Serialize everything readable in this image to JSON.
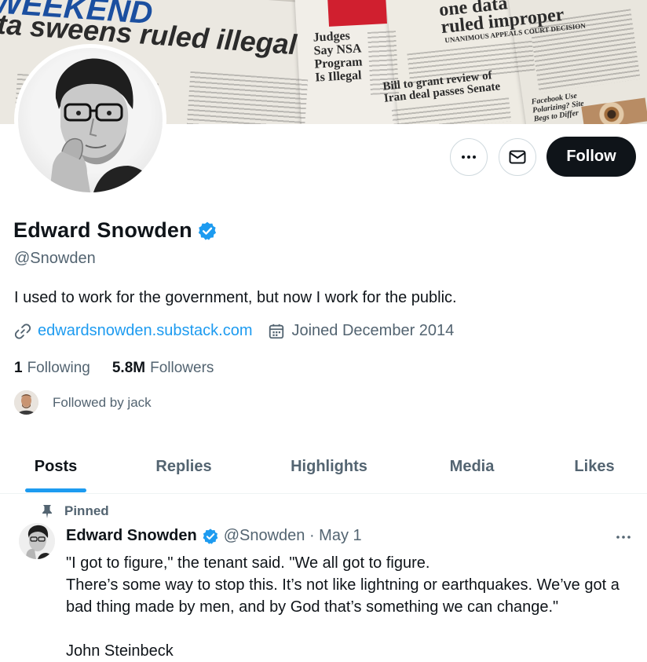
{
  "banner": {
    "headlines": {
      "weekend": "WEEKEND",
      "sweeps": "ta sweens ruled illegal",
      "judges": "Judges\nSay NSA\nProgram\nIs Illegal",
      "data": "one data\nruled improper",
      "appeals": "UNANIMOUS APPEALS COURT DECISION",
      "bill": "Bill to grant review of\nIran deal passes Senate",
      "facebook": "Facebook Use\nPolarizing? Site\nBegs to Differ"
    }
  },
  "profile": {
    "name": "Edward Snowden",
    "handle": "@Snowden",
    "bio": "I used to work for the government, but now I work for the public.",
    "website": "edwardsnowden.substack.com",
    "joined": "Joined December 2014",
    "following_count": "1",
    "following_label": "Following",
    "followers_count": "5.8M",
    "followers_label": "Followers",
    "followed_by": "Followed by jack"
  },
  "actions": {
    "follow_label": "Follow"
  },
  "tabs": [
    {
      "label": "Posts",
      "active": true
    },
    {
      "label": "Replies",
      "active": false
    },
    {
      "label": "Highlights",
      "active": false
    },
    {
      "label": "Media",
      "active": false
    },
    {
      "label": "Likes",
      "active": false
    }
  ],
  "pinned_post": {
    "pinned_label": "Pinned",
    "author": "Edward Snowden",
    "handle_date": "@Snowden · May 1",
    "text": "\"I got to figure,\" the tenant said. \"We all got to figure.\nThere’s some way to stop this. It’s not like lightning or earthquakes. We’ve got a bad thing made by men, and by God that’s something we can change.\"\n\nJohn Steinbeck"
  },
  "colors": {
    "accent": "#1d9bf0",
    "text": "#0f1419",
    "secondary": "#536471",
    "follow_bg": "#0f1419"
  }
}
